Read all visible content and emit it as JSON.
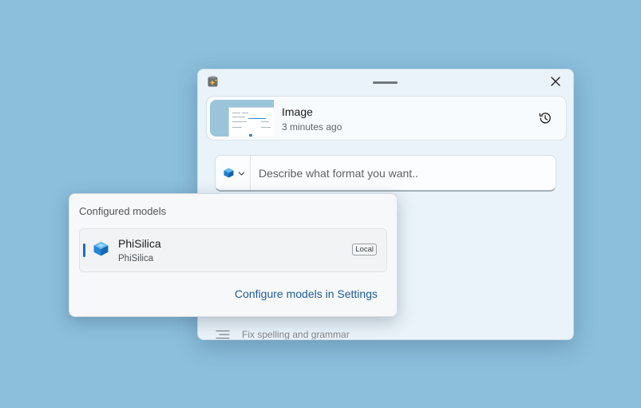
{
  "window": {
    "app_icon": "sparkle-clipboard-icon",
    "close_icon": "close-icon",
    "clipboard_item": {
      "title": "Image",
      "time": "3 minutes ago",
      "history_icon": "history-icon"
    },
    "prompt": {
      "model_picker_icon": "model-cube-icon",
      "chevron_icon": "chevron-down-icon",
      "placeholder": "Describe what format you want.."
    },
    "actions": [
      {
        "label": "Fix spelling and grammar",
        "icon": "lines-icon"
      }
    ]
  },
  "model_flyout": {
    "title": "Configured models",
    "models": [
      {
        "name": "PhiSilica",
        "subtitle": "PhiSilica",
        "badge": "Local",
        "selected": true
      }
    ],
    "settings_link": "Configure models in Settings"
  },
  "colors": {
    "desktop": "#8bbfdc",
    "window_bg": "#eaf3f9",
    "accent": "#1f6bbf",
    "link": "#1c5c9a"
  }
}
